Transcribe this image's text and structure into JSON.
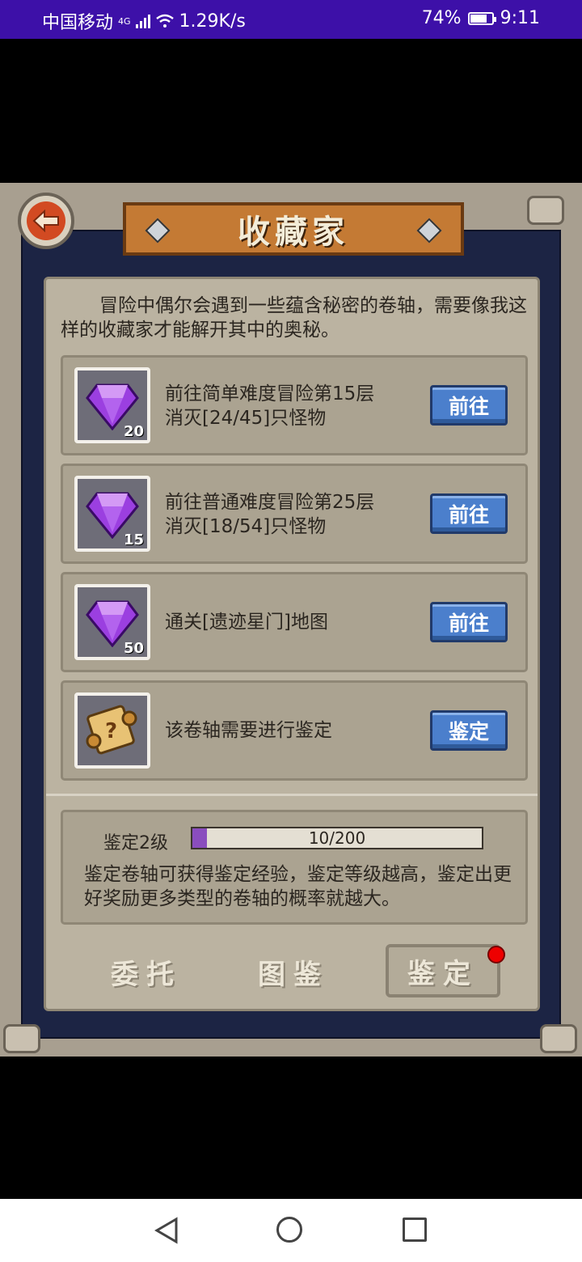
{
  "status_bar": {
    "carrier": "中国移动",
    "network": "4G",
    "speed": "1.29K/s",
    "battery": "74%",
    "battery_level": 0.74,
    "time": "9:11"
  },
  "header": {
    "title": "收藏家"
  },
  "intro_text": "冒险中偶尔会遇到一些蕴含秘密的卷轴，需要像我这样的收藏家才能解开其中的奥秘。",
  "tasks": [
    {
      "icon": "purple-gem-icon",
      "count": "20",
      "line1": "前往简单难度冒险第15层",
      "line2": "消灭[24/45]只怪物",
      "button": "前往"
    },
    {
      "icon": "purple-gem-icon",
      "count": "15",
      "line1": "前往普通难度冒险第25层",
      "line2": "消灭[18/54]只怪物",
      "button": "前往"
    },
    {
      "icon": "purple-gem-icon",
      "count": "50",
      "line1": "通关[遗迹星门]地图",
      "line2": "",
      "button": "前往"
    },
    {
      "icon": "mystery-scroll-icon",
      "count": "",
      "line1": "该卷轴需要进行鉴定",
      "line2": "",
      "button": "鉴定"
    }
  ],
  "appraisal": {
    "level_label": "鉴定2级",
    "progress_text": "10/200",
    "progress_fraction": 0.05,
    "description": "鉴定卷轴可获得鉴定经验，鉴定等级越高，鉴定出更好奖励更多类型的卷轴的概率就越大。"
  },
  "tabs": {
    "commission": "委托",
    "catalog": "图鉴",
    "appraise": "鉴定"
  },
  "colors": {
    "status_bar": "#3d10a8",
    "button_blue": "#4b7fcc",
    "gem_purple": "#9b3fe0",
    "notification_dot": "#ee0000"
  }
}
